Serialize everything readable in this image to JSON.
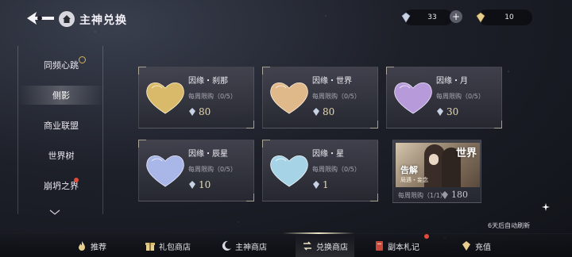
{
  "header": {
    "title": "主神兑换",
    "back_icon": "back-arrow-icon",
    "home_icon": "home-icon",
    "currency_a_value": "33",
    "currency_b_value": "10",
    "plus_label": "+"
  },
  "sidebar": {
    "items": [
      {
        "label": "同频心跳"
      },
      {
        "label": "侧影"
      },
      {
        "label": "商业联盟"
      },
      {
        "label": "世界树"
      },
      {
        "label": "崩坍之界"
      }
    ],
    "active_index": 1
  },
  "shop": {
    "items": [
      {
        "title": "因缘・刹那",
        "limit": "每周限购（0/5）",
        "price": "80",
        "heart_color": "#d9b96a"
      },
      {
        "title": "因缘・世界",
        "limit": "每周限购（0/5）",
        "price": "80",
        "heart_color": "#e0b98a"
      },
      {
        "title": "因缘・月",
        "limit": "每周限购（0/5）",
        "price": "30",
        "heart_color": "#b79ad9"
      },
      {
        "title": "因缘・辰星",
        "limit": "每周限购（0/5）",
        "price": "10",
        "heart_color": "#a9b6e8"
      },
      {
        "title": "因缘・星",
        "limit": "每周限购（0/5）",
        "price": "1",
        "heart_color": "#a6d3e6"
      }
    ],
    "special": {
      "badge": "世界",
      "name": "告解",
      "subtitle": "局遇・妄念",
      "limit": "每周限购（1/1）",
      "price": "180"
    },
    "refresh_note": "6天后自动刷新"
  },
  "bottom_nav": {
    "items": [
      {
        "label": "推荐",
        "icon": "flame-icon"
      },
      {
        "label": "礼包商店",
        "icon": "gift-icon"
      },
      {
        "label": "主神商店",
        "icon": "moon-icon"
      },
      {
        "label": "兑换商店",
        "icon": "exchange-icon"
      },
      {
        "label": "副本札记",
        "icon": "notebook-icon"
      },
      {
        "label": "充值",
        "icon": "crystal-icon"
      }
    ],
    "active_index": 3
  },
  "colors": {
    "accent_gold": "#e8d9a8",
    "badge_red": "#e24a3a"
  }
}
